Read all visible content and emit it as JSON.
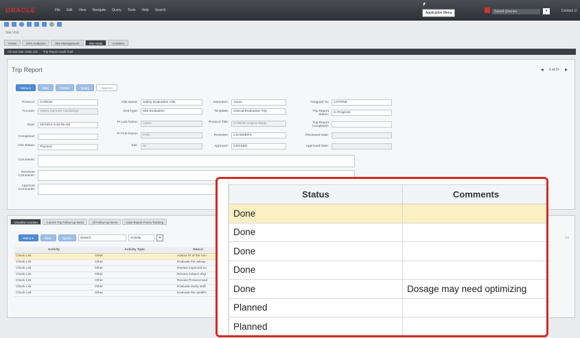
{
  "header": {
    "logo": "ORACLE",
    "menus": [
      "File",
      "Edit",
      "View",
      "Navigate",
      "Query",
      "Tools",
      "Help",
      "Search"
    ],
    "app_menu_tooltip": "Application Menu",
    "saved_queries": "Saved Queries",
    "contact": "Contact U"
  },
  "site_visit_label": "Site Visit",
  "tabs": [
    "Home",
    "CRA Analytics",
    "Site Management",
    "Site Visits",
    "Activities"
  ],
  "subnav": [
    "Clinical Site Visits List",
    "Trip Report Audit Trail"
  ],
  "trip": {
    "title": "Trip Report",
    "pager": "2 of 2+",
    "buttons": {
      "menu": "Menu ▾",
      "new": "New",
      "delete": "Delete",
      "query": "Query",
      "approve": "Approve"
    },
    "fields": {
      "protocol_label": "Protocol:",
      "protocol": "CARDIO",
      "account_label": "Account:",
      "account": "Abbey General Cardiology",
      "start_label": "Start:",
      "start": "02/19/14 8:30:05 AM",
      "completed_label": "Completed:",
      "completed": "",
      "visit_status_label": "Visit Status:",
      "visit_status": "Planned",
      "visit_name_label": "Visit Name:",
      "visit_name": "Safety Evaluation Visit",
      "visit_type_label": "Visit Type:",
      "visit_type": "Site Evaluation",
      "pi_last_label": "PI Last Name:",
      "pi_last": "Aaron",
      "pi_first_label": "PI First Name:",
      "pi_first": "Felix",
      "site_label": "Site:",
      "site": "01",
      "attendees_label": "Attendees:",
      "attendees": "Aaron",
      "template_label": "Template:",
      "template": "Clinical Evaluation Trip",
      "protocol_title_label": "Protocol Title:",
      "protocol_title": "CARDIO Angina Study",
      "reviewer_label": "Reviewer:",
      "reviewer": "CSANDERS",
      "approver_label": "Approver:",
      "approver": "CROSEN",
      "assigned_label": "Assigned To:",
      "assigned": "CSTONE",
      "trip_status_label": "Trip Report Status:",
      "trip_status": "In Progress",
      "trip_completed_label": "Trip Report Completed:",
      "trip_completed": "",
      "reviewed_date_label": "Reviewed Date:",
      "reviewed_date": "",
      "approved_date_label": "Approved Date:",
      "approved_date": "",
      "comments_label": "Comments:",
      "reviewer_comments_label": "Reviewer Comments:",
      "approver_comments_label": "Approver Comments:"
    }
  },
  "activities": {
    "tabs": [
      "Checklist Activities",
      "Current Trip Follow-Up Items",
      "All Follow-Up Items",
      "Case Report Forms Tracking"
    ],
    "menu": "Menu ▾",
    "new": "New",
    "query": "Query",
    "search_placeholder": "Search",
    "filter": "Activity",
    "columns": [
      "Activity",
      "Activity Type",
      "Descri"
    ],
    "rows": [
      [
        "Check List",
        "Other",
        "Advise PI of the non"
      ],
      [
        "Check List",
        "Other",
        "Evaluate the adequ"
      ],
      [
        "Check List",
        "Other",
        "Review expected en"
      ],
      [
        "Check List",
        "Other",
        "Review subject eligi"
      ],
      [
        "Check List",
        "Other",
        "Review Protocol and"
      ],
      [
        "Check List",
        "Other",
        "Evaluate study staff"
      ],
      [
        "Check List",
        "Other",
        "Evaluate the qualific"
      ]
    ]
  },
  "zoom": {
    "columns": [
      "Status",
      "Comments"
    ],
    "rows": [
      {
        "status": "Done",
        "comments": ""
      },
      {
        "status": "Done",
        "comments": ""
      },
      {
        "status": "Done",
        "comments": ""
      },
      {
        "status": "Done",
        "comments": ""
      },
      {
        "status": "Done",
        "comments": "Dosage may need optimizing"
      },
      {
        "status": "Planned",
        "comments": ""
      },
      {
        "status": "Planned",
        "comments": ""
      }
    ]
  }
}
